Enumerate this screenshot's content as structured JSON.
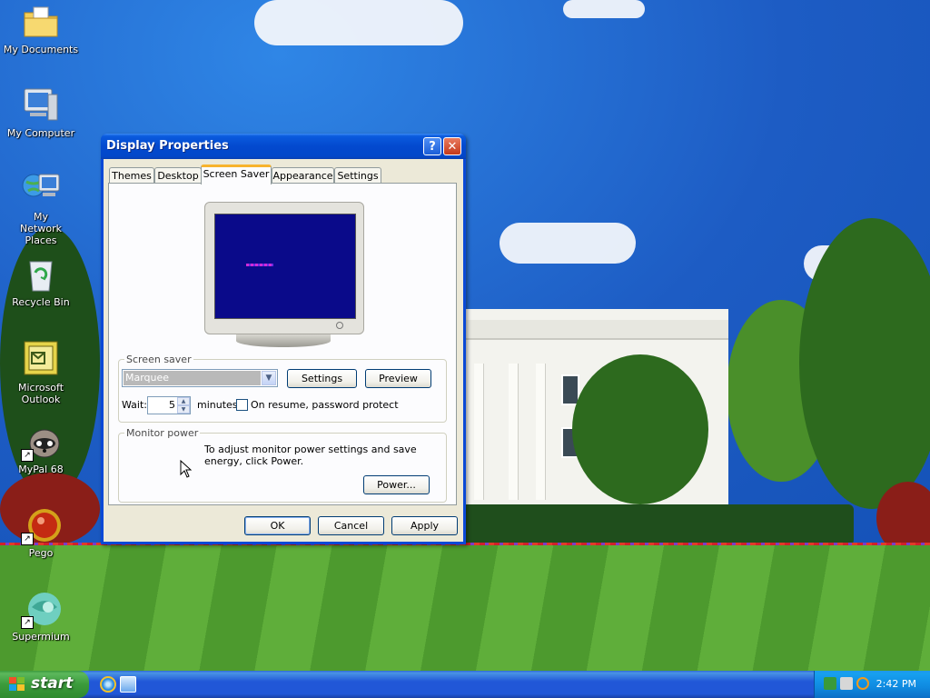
{
  "desktop": {
    "icons": [
      {
        "label": "My Documents",
        "icon": "folder-documents-icon"
      },
      {
        "label": "My Computer",
        "icon": "computer-icon"
      },
      {
        "label": "My Network Places",
        "icon": "network-places-icon"
      },
      {
        "label": "Recycle Bin",
        "icon": "recycle-bin-icon"
      },
      {
        "label": "Microsoft Outlook",
        "icon": "outlook-icon"
      },
      {
        "label": "MyPal 68",
        "icon": "mypal-raccoon-icon"
      },
      {
        "label": "Pego",
        "icon": "pego-icon"
      },
      {
        "label": "Supermium",
        "icon": "supermium-icon"
      }
    ]
  },
  "dialog": {
    "title": "Display Properties",
    "help_glyph": "?",
    "close_glyph": "✕",
    "tabs": [
      "Themes",
      "Desktop",
      "Screen Saver",
      "Appearance",
      "Settings"
    ],
    "active_tab": "Screen Saver",
    "screensaver": {
      "group_title": "Screen saver",
      "selected": "Marquee",
      "settings_button": "Settings",
      "preview_button": "Preview",
      "wait_label": "Wait:",
      "wait_value": "5",
      "minutes_label": "minutes",
      "password_label": "On resume, password protect",
      "password_checked": false
    },
    "monitor_power": {
      "group_title": "Monitor power",
      "text": "To adjust monitor power settings and save energy, click Power.",
      "power_button": "Power..."
    },
    "ok_button": "OK",
    "cancel_button": "Cancel",
    "apply_button": "Apply"
  },
  "taskbar": {
    "start_label": "start",
    "quick_launch": [
      "internet-explorer-icon",
      "show-desktop-icon"
    ],
    "tray_icons": [
      "network-icon",
      "safely-remove-icon",
      "search-icon"
    ],
    "clock": "2:42 PM"
  },
  "colors": {
    "titlebar": "#0349cf",
    "taskbar": "#2157d7",
    "start": "#3b9b3b",
    "active_tab_accent": "#f7b32d"
  }
}
